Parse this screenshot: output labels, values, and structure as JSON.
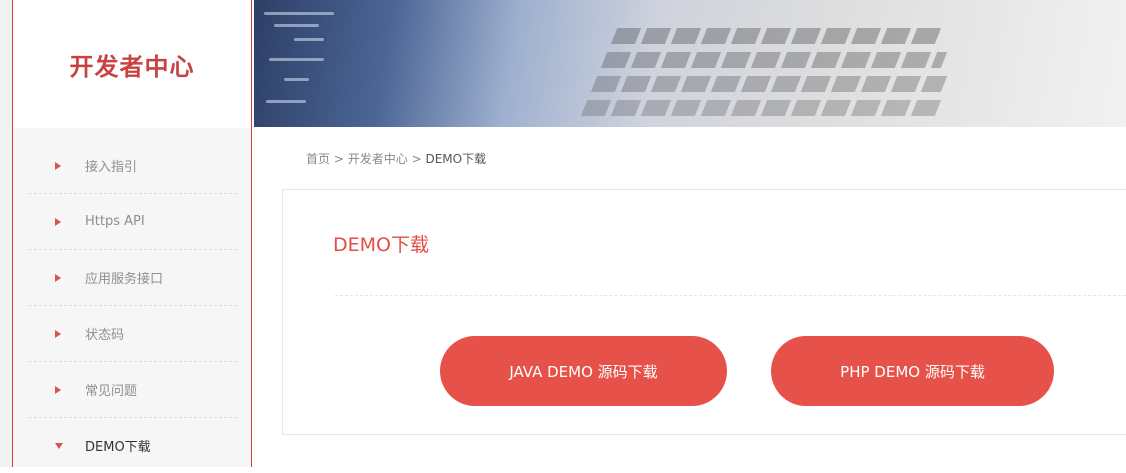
{
  "brand": {
    "title": "开发者中心"
  },
  "sidebar": {
    "items": [
      {
        "label": "接入指引",
        "icon": "chevron-right-icon",
        "active": false
      },
      {
        "label": "Https API",
        "icon": "chevron-right-icon",
        "active": false
      },
      {
        "label": "应用服务接口",
        "icon": "chevron-right-icon",
        "active": false
      },
      {
        "label": "状态码",
        "icon": "chevron-right-icon",
        "active": false
      },
      {
        "label": "常见问题",
        "icon": "chevron-right-icon",
        "active": false
      },
      {
        "label": "DEMO下载",
        "icon": "chevron-down-icon",
        "active": true
      }
    ]
  },
  "breadcrumb": {
    "home": "首页",
    "separator": ">",
    "parent": "开发者中心",
    "current": "DEMO下载"
  },
  "panel": {
    "title": "DEMO下载",
    "java_button": "JAVA DEMO 源码下载",
    "php_button": "PHP DEMO 源码下载"
  },
  "colors": {
    "accent": "#e65249",
    "brand_text": "#c94242",
    "sidebar_border": "#d33e3e",
    "icon": "#d9534f"
  }
}
